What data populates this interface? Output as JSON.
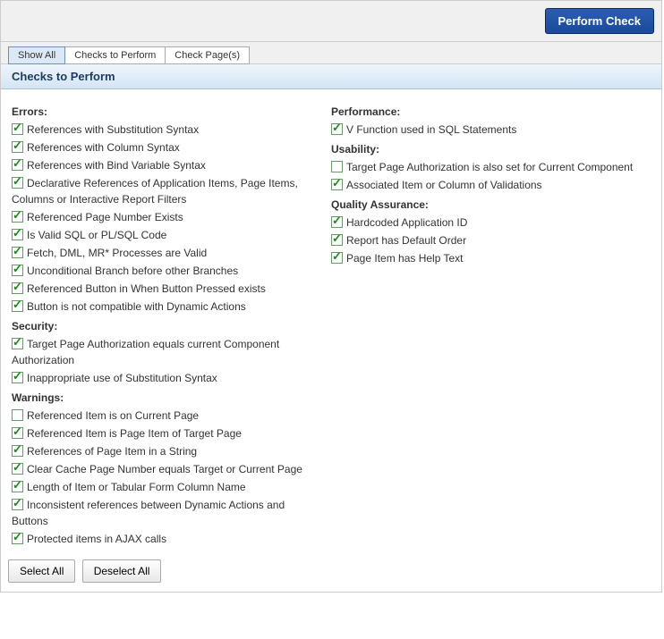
{
  "header": {
    "perform_check": "Perform Check"
  },
  "tabs": {
    "show_all": "Show All",
    "checks_to_perform": "Checks to Perform",
    "check_pages": "Check Page(s)"
  },
  "section_title": "Checks to Perform",
  "groups": {
    "errors": {
      "title": "Errors:",
      "items": [
        {
          "label": "References with Substitution Syntax",
          "checked": true
        },
        {
          "label": "References with Column Syntax",
          "checked": true
        },
        {
          "label": "References with Bind Variable Syntax",
          "checked": true
        },
        {
          "label": "Declarative References of Application Items, Page Items, Columns or Interactive Report Filters",
          "checked": true
        },
        {
          "label": "Referenced Page Number Exists",
          "checked": true
        },
        {
          "label": "Is Valid SQL or PL/SQL Code",
          "checked": true
        },
        {
          "label": "Fetch, DML, MR* Processes are Valid",
          "checked": true
        },
        {
          "label": "Unconditional Branch before other Branches",
          "checked": true
        },
        {
          "label": "Referenced Button in When Button Pressed exists",
          "checked": true
        },
        {
          "label": "Button is not compatible with Dynamic Actions",
          "checked": true
        }
      ]
    },
    "security": {
      "title": "Security:",
      "items": [
        {
          "label": "Target Page Authorization equals current Component Authorization",
          "checked": true
        },
        {
          "label": "Inappropriate use of Substitution Syntax",
          "checked": true
        }
      ]
    },
    "warnings": {
      "title": "Warnings:",
      "items": [
        {
          "label": "Referenced Item is on Current Page",
          "checked": false
        },
        {
          "label": "Referenced Item is Page Item of Target Page",
          "checked": true
        },
        {
          "label": "References of Page Item in a String",
          "checked": true
        },
        {
          "label": "Clear Cache Page Number equals Target or Current Page",
          "checked": true
        },
        {
          "label": "Length of Item or Tabular Form Column Name",
          "checked": true
        },
        {
          "label": "Inconsistent references between Dynamic Actions and Buttons",
          "checked": true
        },
        {
          "label": "Protected items in AJAX calls",
          "checked": true
        }
      ]
    },
    "performance": {
      "title": "Performance:",
      "items": [
        {
          "label": "V Function used in SQL Statements",
          "checked": true
        }
      ]
    },
    "usability": {
      "title": "Usability:",
      "items": [
        {
          "label": "Target Page Authorization is also set for Current Component",
          "checked": false
        },
        {
          "label": "Associated Item or Column of Validations",
          "checked": true
        }
      ]
    },
    "quality_assurance": {
      "title": "Quality Assurance:",
      "items": [
        {
          "label": "Hardcoded Application ID",
          "checked": true
        },
        {
          "label": "Report has Default Order",
          "checked": true
        },
        {
          "label": "Page Item has Help Text",
          "checked": true
        }
      ]
    }
  },
  "footer": {
    "select_all": "Select All",
    "deselect_all": "Deselect All"
  }
}
